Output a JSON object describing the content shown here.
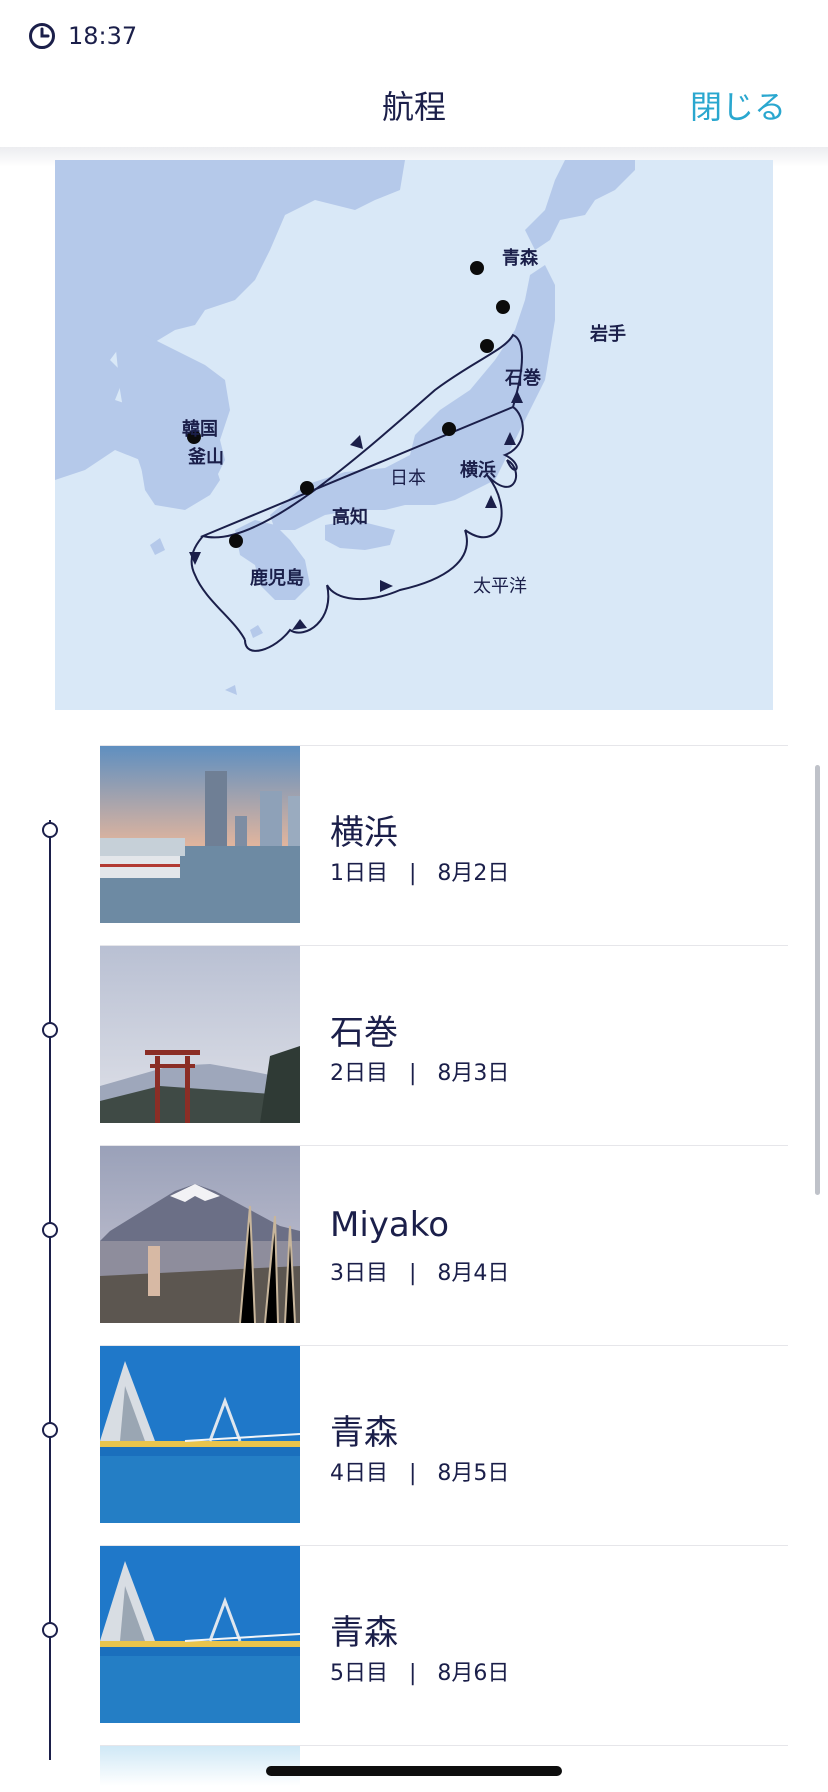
{
  "status": {
    "time": "18:37"
  },
  "header": {
    "title": "航程",
    "close_label": "閉じる"
  },
  "map": {
    "labels": {
      "aomori": "青森",
      "iwate": "岩手",
      "ishinomaki": "石巻",
      "korea": "韓国",
      "busan": "釜山",
      "japan": "日本",
      "yokohama": "横浜",
      "kochi": "高知",
      "kagoshima": "鹿児島",
      "pacific": "太平洋"
    }
  },
  "itinerary": [
    {
      "name": "横浜",
      "day": "1日目",
      "date": "8月2日"
    },
    {
      "name": "石巻",
      "day": "2日目",
      "date": "8月3日"
    },
    {
      "name": "Miyako",
      "day": "3日目",
      "date": "8月4日"
    },
    {
      "name": "青森",
      "day": "4日目",
      "date": "8月5日"
    },
    {
      "name": "青森",
      "day": "5日目",
      "date": "8月6日"
    }
  ],
  "colors": {
    "accent": "#2aa7cf",
    "text": "#1b1f4a",
    "sea": "#d9e8f7",
    "land": "#b5c9ea"
  }
}
